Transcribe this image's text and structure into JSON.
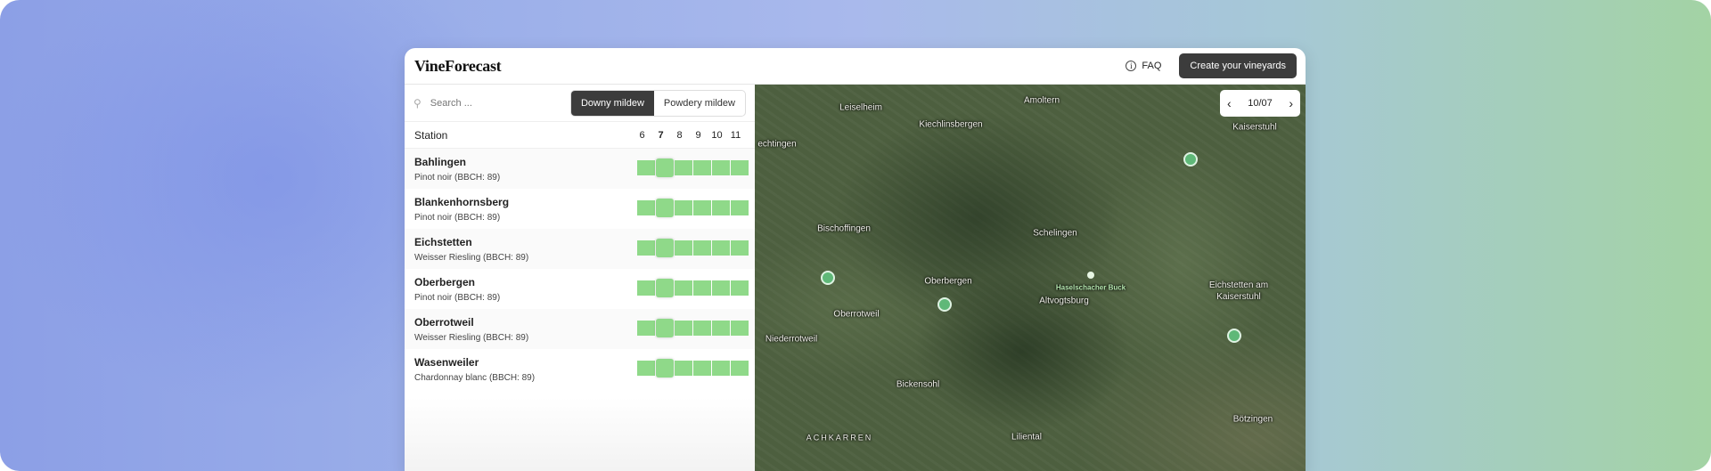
{
  "app": {
    "logo": "VineForecast"
  },
  "header": {
    "faq_label": "FAQ",
    "faq_icon": "info-icon",
    "cta_label": "Create your vineyards"
  },
  "search": {
    "placeholder": "Search ...",
    "icon": "search-icon"
  },
  "disease_toggle": {
    "options": [
      "Downy mildew",
      "Powdery mildew"
    ],
    "selected": "Downy mildew"
  },
  "table": {
    "station_header": "Station",
    "days": [
      "6",
      "7",
      "8",
      "9",
      "10",
      "11"
    ],
    "highlighted_day": "7",
    "risk_color": "#8fd989",
    "rows": [
      {
        "name": "Bahlingen",
        "variety": "Pinot noir (BBCH: 89)"
      },
      {
        "name": "Blankenhornsberg",
        "variety": "Pinot noir (BBCH: 89)"
      },
      {
        "name": "Eichstetten",
        "variety": "Weisser Riesling (BBCH: 89)"
      },
      {
        "name": "Oberbergen",
        "variety": "Pinot noir (BBCH: 89)"
      },
      {
        "name": "Oberrotweil",
        "variety": "Weisser Riesling (BBCH: 89)"
      },
      {
        "name": "Wasenweiler",
        "variety": "Chardonnay blanc (BBCH: 89)"
      }
    ]
  },
  "map": {
    "date": "10/07",
    "marker_color": "#5fb878",
    "places": [
      "Leiselheim",
      "Kiechlinsbergen",
      "Amoltern",
      "echtingen",
      "Kaiserstuhl",
      "Bischoffingen",
      "Schelingen",
      "Oberbergen",
      "Haselschacher Buck",
      "Altvogtsburg",
      "Eichstetten am Kaiserstuhl",
      "Oberrotweil",
      "Niederrotweil",
      "Bickensohl",
      "ACHKARREN",
      "Liliental",
      "Bötzingen"
    ]
  }
}
